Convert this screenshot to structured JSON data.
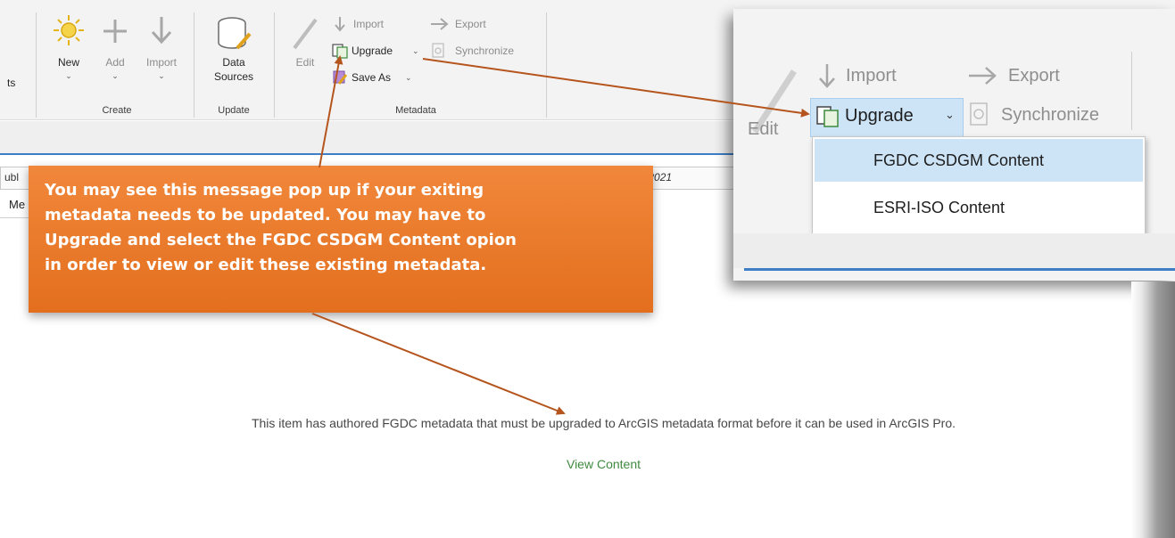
{
  "ribbon": {
    "cut_text": "ts",
    "create": {
      "new_label": "New",
      "add_label": "Add",
      "import_label": "Import",
      "group_title": "Create"
    },
    "update": {
      "data_label": "Data",
      "sources_label": "Sources",
      "group_title": "Update"
    },
    "metadata": {
      "edit_label": "Edit",
      "import_label": "Import",
      "export_label": "Export",
      "upgrade_label": "Upgrade",
      "synchronize_label": "Synchronize",
      "save_as_label": "Save As",
      "group_title": "Metadata"
    }
  },
  "fields": {
    "left_text": "ubl",
    "right_text": "n_2021",
    "tab_text": "Me"
  },
  "zoom": {
    "import_label": "Import",
    "export_label": "Export",
    "edit_label": "Edit",
    "upgrade_label": "Upgrade",
    "synchronize_label": "Synchronize",
    "menu_items": [
      "FGDC CSDGM Content",
      "ESRI-ISO Content"
    ]
  },
  "callout": {
    "text": "You may see this message pop up if your exiting\nmetadata needs to be updated.  You may have to\nUpgrade and select the FGDC CSDGM Content opion\nin order to view or edit these existing metadata."
  },
  "message": {
    "text": "This item has authored FGDC metadata that must be upgraded to ArcGIS metadata format before it can be used in ArcGIS Pro.",
    "link": "View Content"
  },
  "colors": {
    "callout": "#e97a2c",
    "arrow": "#b5541c",
    "accent_blue": "#3d7ec6",
    "menu_highlight": "#cde4f7",
    "link": "#3f8a3f"
  }
}
